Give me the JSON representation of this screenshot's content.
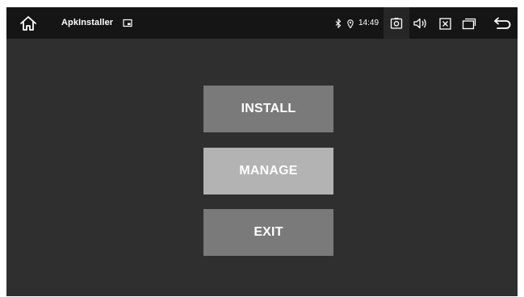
{
  "status_bar": {
    "app_title": "ApkInstaller",
    "time": "14:49",
    "icons": {
      "home": "home-icon",
      "cast": "cast-icon",
      "bluetooth": "bluetooth-icon",
      "location": "location-icon",
      "screenshot": "screenshot-icon",
      "volume": "volume-icon",
      "close_app": "close-app-icon",
      "recents": "recents-icon",
      "back": "back-icon"
    }
  },
  "menu": {
    "install_label": "INSTALL",
    "manage_label": "MANAGE",
    "exit_label": "EXIT"
  },
  "colors": {
    "background": "#2f2f2f",
    "status_bar": "#151515",
    "button": "#7a7a7a",
    "button_selected": "#b3b3b3",
    "text": "#ffffff"
  }
}
